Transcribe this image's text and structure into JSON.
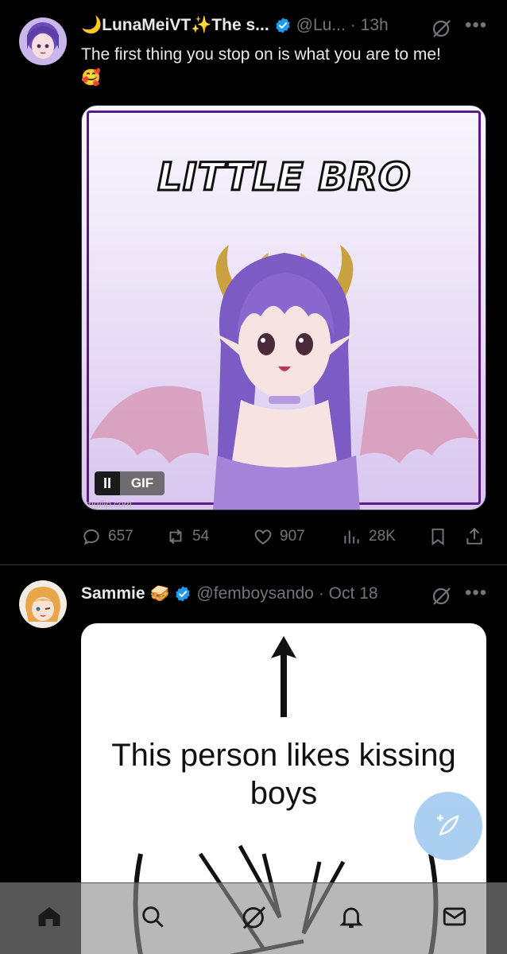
{
  "post1": {
    "display_name": "🌙LunaMeiVT✨The s...",
    "handle": "@Lu...",
    "time": "· 13h",
    "text": "The first thing you stop on is what you are to me!",
    "text_emoji": "🥰",
    "gif": {
      "overlay_text": "LITTLE BRO",
      "pause_label": "II",
      "badge_label": "GIF",
      "watermark": "imgflip.com"
    },
    "stats": {
      "replies": "657",
      "reposts": "54",
      "likes": "907",
      "views": "28K"
    }
  },
  "post2": {
    "display_name": "Sammie",
    "name_emoji": "🥪",
    "handle": "@femboysando",
    "time": "· Oct 18",
    "image_text": "This person likes kissing boys"
  },
  "colors": {
    "background": "#000000",
    "text": "#e7e9ea",
    "muted": "#71767b",
    "verified": "#1d9bf0",
    "compose": "#a6cdf0"
  },
  "icons": {
    "nav": [
      "home-icon",
      "search-icon",
      "grok-icon",
      "bell-icon",
      "mail-icon"
    ],
    "actions": [
      "reply-icon",
      "repost-icon",
      "like-icon",
      "views-icon",
      "bookmark-icon",
      "share-icon"
    ]
  }
}
